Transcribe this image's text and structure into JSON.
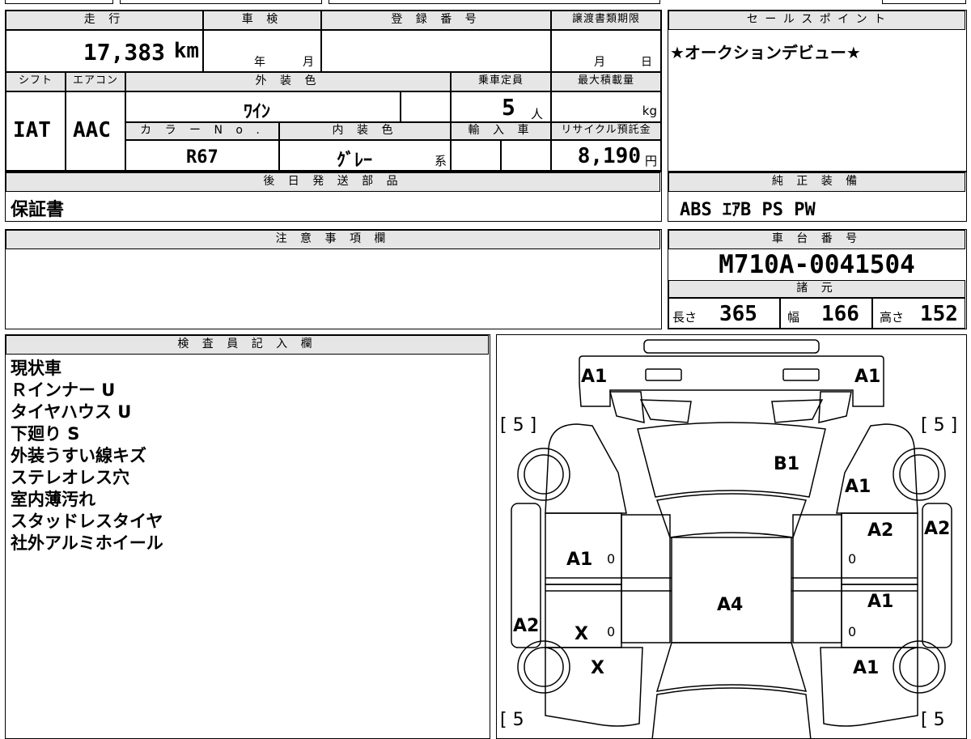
{
  "mileage": {
    "label": "走 行",
    "value": "17,383",
    "unit": "km"
  },
  "inspection": {
    "label": "車 検",
    "year": "年",
    "month": "月"
  },
  "registration": {
    "label": "登 録 番 号"
  },
  "transfer": {
    "label": "譲渡書類期限",
    "month": "月",
    "day": "日"
  },
  "sales_point": {
    "label": "セ ー ル ス ポ イ ン ト",
    "text": "★オークションデビュー★"
  },
  "shift": {
    "label": "シフト",
    "value": "IAT"
  },
  "aircon": {
    "label": "エアコン",
    "value": "AAC"
  },
  "exterior_color": {
    "label": "外 装 色",
    "value": "ﾜｲﾝ"
  },
  "capacity": {
    "label": "乗車定員",
    "value": "5",
    "unit": "人"
  },
  "max_load": {
    "label": "最大積載量",
    "unit": "kg"
  },
  "color_no": {
    "label": "カ ラ ー N o .",
    "value": "R67"
  },
  "interior_color": {
    "label": "内 装 色",
    "value": "ｸﾞﾚｰ",
    "suffix": "系"
  },
  "import": {
    "label": "輸 入 車"
  },
  "recycle": {
    "label": "リサイクル預託金",
    "value": "8,190",
    "unit": "円"
  },
  "later_parts": {
    "label": "後 日 発 送 部 品",
    "value": "保証書"
  },
  "equipment": {
    "label": "純 正 装 備",
    "value": "ABS ｴｱB PS PW"
  },
  "notes": {
    "label": "注 意 事 項 欄"
  },
  "chassis": {
    "label": "車 台 番 号",
    "value": "M710A-0041504"
  },
  "specs": {
    "label": "諸 元",
    "length_label": "長さ",
    "length": "365",
    "width_label": "幅",
    "width": "166",
    "height_label": "高さ",
    "height": "152"
  },
  "inspector": {
    "label": "検 査 員 記 入 欄",
    "items": [
      "現状車",
      "Ｒインナー U",
      "タイヤハウス U",
      "下廻り S",
      "外装うすい線キズ",
      "ステレオレス穴",
      "室内薄汚れ",
      "スタッドレスタイヤ",
      "社外アルミホイール"
    ]
  },
  "diagram": {
    "tire_marks": [
      "[ 5 ]",
      "[ 5 ]",
      "[ 5",
      "[ 5"
    ],
    "marks": {
      "front_left": "A1",
      "front_right": "A1",
      "hood": "B1",
      "right_fender": "A1",
      "right_front_door": "A2",
      "right_mirror": "A2",
      "left_front_door": "A1",
      "left_front_door_zero": "0",
      "right_front_door_zero": "0",
      "roof": "A4",
      "right_rear_door": "A1",
      "left_rear_door": "X",
      "left_rear_door_zero": "0",
      "right_rear_door_zero": "0",
      "left_side": "A2",
      "left_quarter": "X",
      "right_quarter": "A1"
    }
  }
}
